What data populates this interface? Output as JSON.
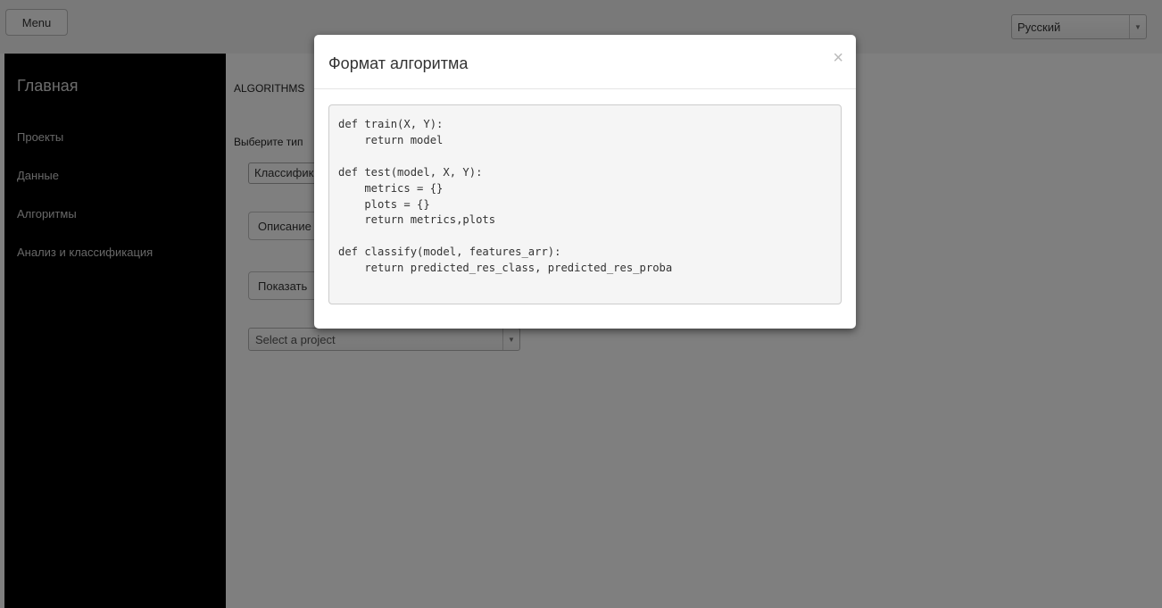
{
  "topbar": {
    "menu_label": "Menu",
    "language": {
      "selected": "Русский",
      "arrow_icon": "caret-down"
    }
  },
  "sidebar": {
    "home": "Главная",
    "items": [
      {
        "label": "Проекты"
      },
      {
        "label": "Данные"
      },
      {
        "label": "Алгоритмы"
      },
      {
        "label": "Анализ и классификация"
      }
    ]
  },
  "main": {
    "title": "ALGORITHMS",
    "choose_label": "Выберите тип",
    "type_select": "Классификация",
    "description_button": "Описание",
    "show_button": "Показать",
    "project_select": {
      "placeholder": "Select a project",
      "arrow_icon": "caret-down"
    }
  },
  "modal": {
    "title": "Формат алгоритма",
    "close_label": "×",
    "code": "def train(X, Y):\n    return model\n\ndef test(model, X, Y):\n    metrics = {}\n    plots = {}\n    return metrics,plots\n\ndef classify(model, features_arr):\n    return predicted_res_class, predicted_res_proba"
  },
  "colors": {
    "sidebar_bg": "#000000",
    "backdrop": "rgba(0,0,0,0.5)",
    "modal_bg": "#ffffff",
    "code_bg": "#f5f5f5"
  }
}
